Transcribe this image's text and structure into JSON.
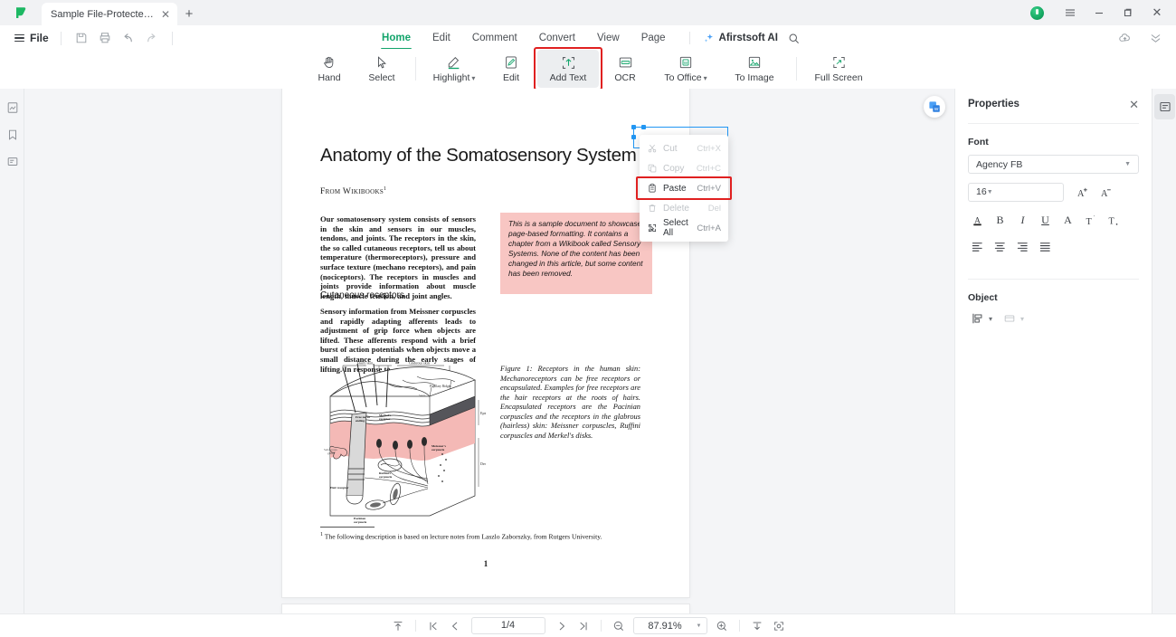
{
  "titlebar": {
    "tab_title": "Sample File-Protected (1...",
    "tab_close": "✕",
    "new_tab": "+",
    "window_min": "—",
    "window_restore": "restore-icon",
    "window_close": "✕",
    "menu_icon": "hamburger-icon",
    "avatar": "user-avatar"
  },
  "filebar": {
    "file_label": "File",
    "quick_tools": [
      "save-icon",
      "print-icon",
      "undo-icon",
      "redo-icon"
    ],
    "right_tools": [
      "cloud-upload-icon",
      "collapse-ribbon-icon"
    ]
  },
  "menu": {
    "items": [
      {
        "label": "Home",
        "active": true
      },
      {
        "label": "Edit",
        "active": false
      },
      {
        "label": "Comment",
        "active": false
      },
      {
        "label": "Convert",
        "active": false
      },
      {
        "label": "View",
        "active": false
      },
      {
        "label": "Page",
        "active": false
      }
    ],
    "ai_label": "Afirstsoft AI",
    "ai_icon": "sparkle-icon",
    "search_icon": "search-icon",
    "accent": "#12a46b"
  },
  "ribbon": {
    "tools": [
      {
        "label": "Hand",
        "icon": "hand-icon",
        "selected": false,
        "highlighted": false,
        "caret": false
      },
      {
        "label": "Select",
        "icon": "cursor-icon",
        "selected": false,
        "highlighted": false,
        "caret": false
      },
      {
        "label": "Highlight",
        "icon": "highlighter-icon",
        "selected": false,
        "highlighted": false,
        "caret": true
      },
      {
        "label": "Edit",
        "icon": "edit-page-icon",
        "selected": false,
        "highlighted": false,
        "caret": false
      },
      {
        "label": "Add Text",
        "icon": "add-text-icon",
        "selected": true,
        "highlighted": true,
        "caret": false
      },
      {
        "label": "OCR",
        "icon": "ocr-icon",
        "selected": false,
        "highlighted": false,
        "caret": false
      },
      {
        "label": "To Office",
        "icon": "to-office-icon",
        "selected": false,
        "highlighted": false,
        "caret": true
      },
      {
        "label": "To Image",
        "icon": "to-image-icon",
        "selected": false,
        "highlighted": false,
        "caret": false
      },
      {
        "label": "Full Screen",
        "icon": "fullscreen-icon",
        "selected": false,
        "highlighted": false,
        "caret": false
      }
    ],
    "highlight_color": "#e02020"
  },
  "leftrail": {
    "items": [
      "thumbnails-icon",
      "bookmark-icon",
      "comments-icon"
    ]
  },
  "context_menu": {
    "items": [
      {
        "label": "Cut",
        "shortcut": "Ctrl+X",
        "icon": "scissors-icon",
        "disabled": true,
        "highlighted": false
      },
      {
        "label": "Copy",
        "shortcut": "Ctrl+C",
        "icon": "copy-icon",
        "disabled": true,
        "highlighted": false
      },
      {
        "label": "Paste",
        "shortcut": "Ctrl+V",
        "icon": "clipboard-icon",
        "disabled": false,
        "highlighted": true
      },
      {
        "label": "Delete",
        "shortcut": "Del",
        "icon": "trash-icon",
        "disabled": true,
        "highlighted": false
      },
      {
        "label": "Select All",
        "shortcut": "Ctrl+A",
        "icon": "select-all-icon",
        "disabled": false,
        "highlighted": false
      }
    ]
  },
  "float_button": {
    "icon": "convert-to-word-icon"
  },
  "document": {
    "title": "Anatomy of the Somatosensory System",
    "from": "From Wikibooks",
    "from_sup": "1",
    "paragraph1": "Our somatosensory system consists of sensors in the skin and sensors in our muscles, tendons, and joints. The receptors in the skin, the so called cutaneous receptors, tell us about temperature (thermoreceptors), pressure and surface texture (mechano receptors), and pain (nociceptors). The receptors in muscles and joints provide information about muscle length, muscle tension, and joint angles.",
    "heading2": "Cutaneous receptors",
    "paragraph2": "Sensory information from Meissner corpuscles and rapidly adapting afferents leads to adjustment of grip force when objects are lifted. These afferents respond with a brief burst of action potentials when objects move a small distance during the early stages of lifting. In response to",
    "pink_note": "This is a sample document to showcase page-based formatting. It contains a chapter from a Wikibook called Sensory Systems. None of the content has been changed in this article, but some content has been removed.",
    "pink_note_color": "#f8c6c3",
    "figure_caption": "Figure 1: Receptors in the human skin: Mechanoreceptors can be free receptors or encapsulated. Examples for free receptors are the hair receptors at the roots of hairs. Encapsulated receptors are the Pacinian corpuscles and the receptors in the glabrous (hairless) skin: Meissner corpuscles, Ruffini corpuscles and Merkel's disks.",
    "figure_labels": {
      "hairy_skin": "Hairy skin",
      "glabrous_skin": "Glabrous skin",
      "papillary_ridges": "Papillary Ridges",
      "epidermis": "Epidermis",
      "dermis": "Dermis",
      "free_nerve": "Free nerve ending",
      "merkel": "Merkel's receptor",
      "septa": "Septa",
      "meissner": "Meissner's corpuscle",
      "ruffini": "Ruffini's corpuscle",
      "sebaceous": "Sebaceous gland",
      "hair_receptor": "Hair receptor",
      "pacinian": "Pacinian corpuscle"
    },
    "footnote_marker": "1",
    "footnote": "The following description is based on lecture notes from Laszlo Zaborszky, from Rutgers University.",
    "page_number": "1"
  },
  "properties": {
    "title": "Properties",
    "close_icon": "close-icon",
    "font_section": "Font",
    "font_family": "Agency FB",
    "font_size": "16",
    "increase_font_icon": "increase-font-icon",
    "decrease_font_icon": "decrease-font-icon",
    "format_buttons": [
      {
        "icon": "font-color-icon",
        "glyph": "A"
      },
      {
        "icon": "bold-icon",
        "glyph": "B"
      },
      {
        "icon": "italic-icon",
        "glyph": "I"
      },
      {
        "icon": "underline-icon",
        "glyph": "U"
      },
      {
        "icon": "strikethrough-icon",
        "glyph": "A"
      },
      {
        "icon": "superscript-icon",
        "glyph": "T"
      },
      {
        "icon": "subscript-icon",
        "glyph": "T"
      }
    ],
    "align_buttons": [
      {
        "icon": "align-left-icon"
      },
      {
        "icon": "align-center-icon"
      },
      {
        "icon": "align-right-icon"
      },
      {
        "icon": "align-justify-icon"
      }
    ],
    "object_section": "Object",
    "object_buttons": [
      {
        "icon": "align-objects-icon",
        "caret": true
      },
      {
        "icon": "arrange-objects-icon",
        "caret": true
      }
    ]
  },
  "rightrail": {
    "items": [
      "properties-panel-icon"
    ]
  },
  "statusbar": {
    "fit_icon": "fit-page-icon",
    "first_page_icon": "first-page-icon",
    "prev_page_icon": "prev-page-icon",
    "page_value": "1/4",
    "next_page_icon": "next-page-icon",
    "last_page_icon": "last-page-icon",
    "zoom_out_icon": "zoom-out-icon",
    "zoom_value": "87.91%",
    "zoom_caret": "chevron-down-icon",
    "zoom_in_icon": "zoom-in-icon",
    "fit_width_icon": "fit-width-icon",
    "fit_screen_icon": "fit-screen-icon"
  }
}
